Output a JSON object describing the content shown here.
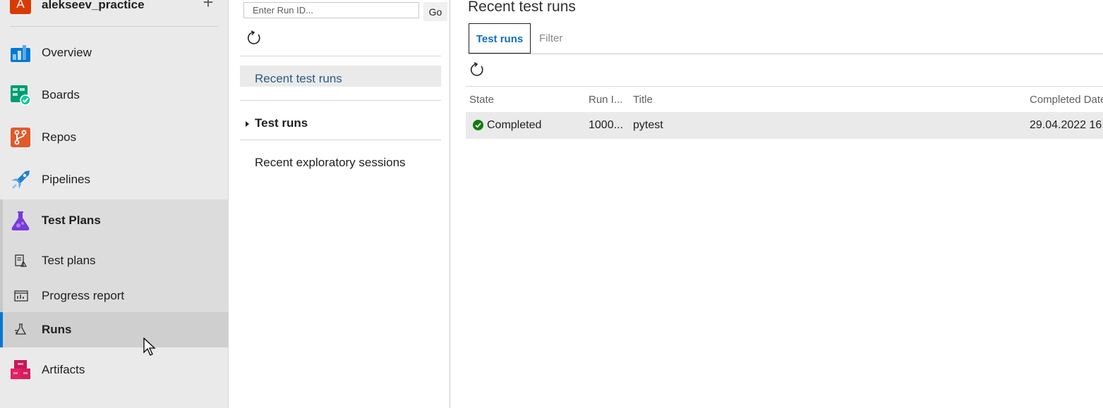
{
  "project": {
    "avatar_letter": "A",
    "name": "alekseev_practice",
    "add_glyph": "+"
  },
  "nav": {
    "items": [
      {
        "label": "Overview",
        "icon": "overview-icon"
      },
      {
        "label": "Boards",
        "icon": "boards-icon"
      },
      {
        "label": "Repos",
        "icon": "repos-icon"
      },
      {
        "label": "Pipelines",
        "icon": "pipelines-icon"
      },
      {
        "label": "Test Plans",
        "icon": "test-plans-icon"
      },
      {
        "label": "Artifacts",
        "icon": "artifacts-icon"
      }
    ],
    "sub_items": [
      {
        "label": "Test plans",
        "icon": "test-plans-list-icon"
      },
      {
        "label": "Progress report",
        "icon": "progress-report-icon"
      },
      {
        "label": "Runs",
        "icon": "runs-icon"
      }
    ]
  },
  "middle": {
    "runid_placeholder": "Enter Run ID...",
    "go_label": "Go",
    "items": [
      {
        "label": "Recent test runs"
      },
      {
        "label": "Test runs"
      },
      {
        "label": "Recent exploratory sessions"
      }
    ]
  },
  "main": {
    "title": "Recent test runs",
    "tabs": [
      {
        "label": "Test runs"
      },
      {
        "label": "Filter"
      }
    ],
    "columns": [
      "State",
      "Run I...",
      "Title",
      "Completed Date"
    ],
    "rows": [
      {
        "state": "Completed",
        "run_id": "1000...",
        "title": "pytest",
        "completed": "29.04.2022 16:"
      }
    ]
  },
  "colors": {
    "accent": "#0078d4",
    "success": "#107c10",
    "avatar": "#d83b01"
  }
}
